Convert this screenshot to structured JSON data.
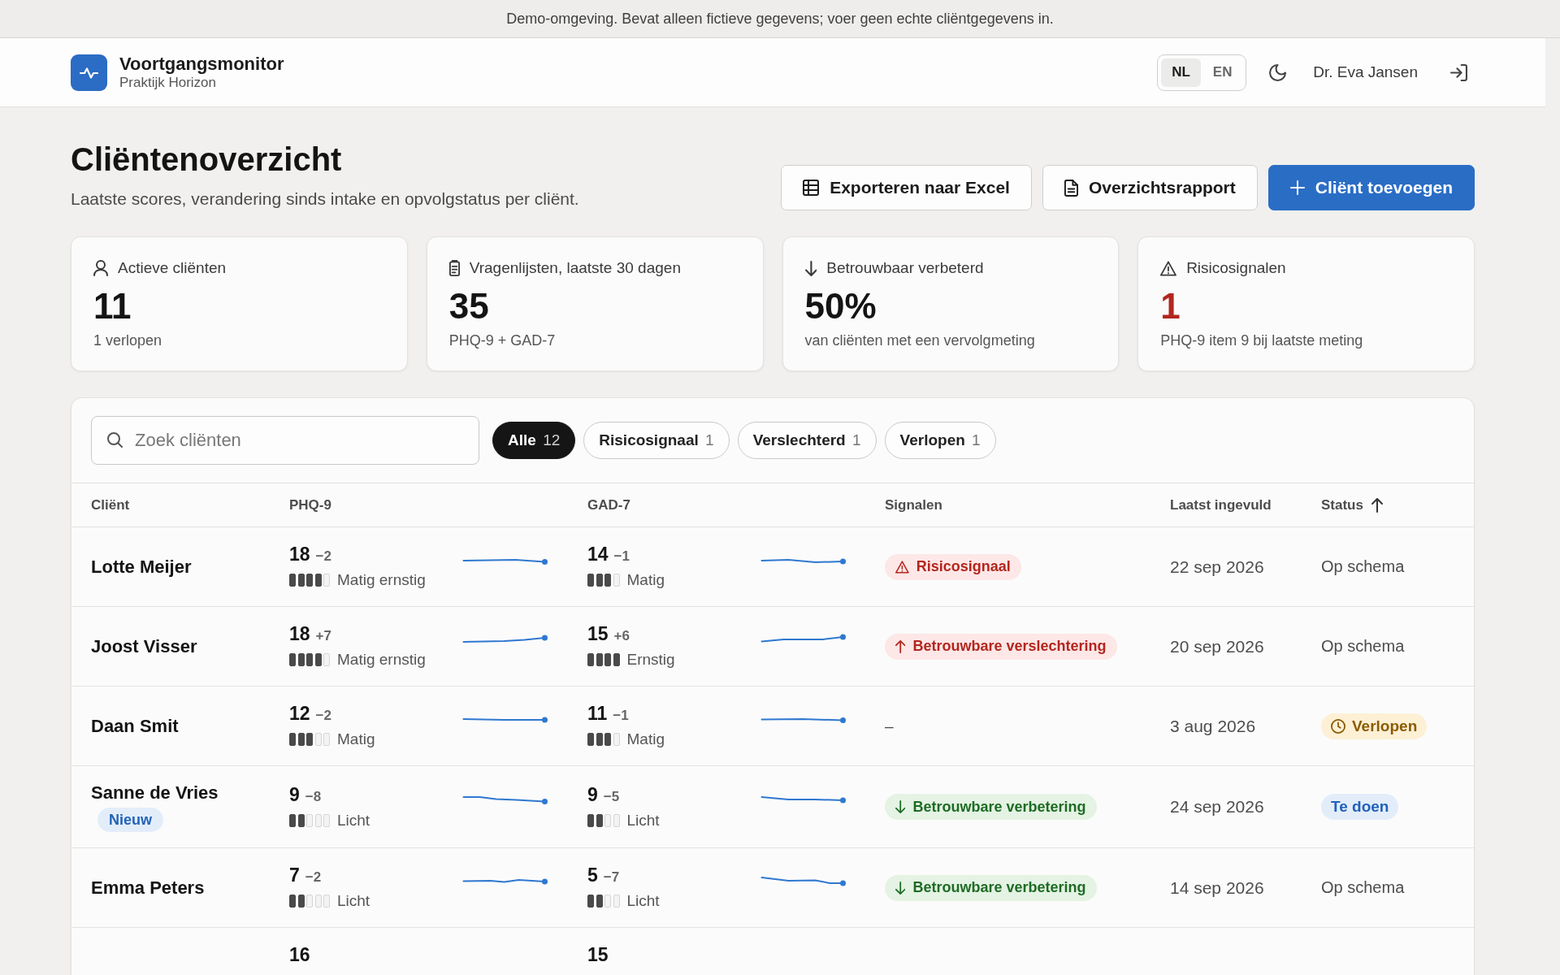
{
  "demo_banner": {
    "text": "Demo-omgeving. Bevat alleen fictieve gegevens; voer geen echte cliëntgegevens in."
  },
  "app_header": {
    "title": "Voortgangsmonitor",
    "subtitle": "Praktijk Horizon",
    "languages": [
      {
        "label": "NL",
        "selected": true
      },
      {
        "label": "EN",
        "selected": false
      }
    ],
    "user": "Dr. Eva Jansen"
  },
  "page": {
    "title": "Cliëntenoverzicht",
    "subtitle": "Laatste scores, verandering sinds intake en opvolgstatus per cliënt.",
    "actions": [
      {
        "label": "Exporteren naar Excel",
        "kind": "secondary"
      },
      {
        "label": "Overzichtsrapport",
        "kind": "secondary"
      },
      {
        "label": "Cliënt toevoegen",
        "kind": "primary"
      }
    ]
  },
  "stats": [
    {
      "label": "Actieve cliënten",
      "value": "11",
      "note": "1 verlopen",
      "alert": false
    },
    {
      "label": "Vragenlijsten, laatste 30 dagen",
      "value": "35",
      "note": "PHQ-9 + GAD-7",
      "alert": false
    },
    {
      "label": "Betrouwbaar verbeterd",
      "value": "50%",
      "note": "van cliënten met een vervolgmeting",
      "alert": false
    },
    {
      "label": "Risicosignalen",
      "value": "1",
      "note": "PHQ-9 item 9 bij laatste meting",
      "alert": true
    }
  ],
  "client_table": {
    "search": {
      "placeholder": "Zoek cliënten"
    },
    "filters": [
      {
        "label": "Alle",
        "count": "12",
        "selected": true
      },
      {
        "label": "Risicosignaal",
        "count": "1",
        "selected": false
      },
      {
        "label": "Verslechterd",
        "count": "1",
        "selected": false
      },
      {
        "label": "Verlopen",
        "count": "1",
        "selected": false
      }
    ],
    "columns": [
      {
        "label": "Cliënt",
        "sorted": false
      },
      {
        "label": "PHQ-9",
        "sorted": false
      },
      {
        "label": "GAD-7",
        "sorted": false
      },
      {
        "label": "Signalen",
        "sorted": false
      },
      {
        "label": "Laatst ingevuld",
        "sorted": false
      },
      {
        "label": "Status",
        "sorted": true
      }
    ],
    "rows": [
      {
        "name": "Lotte Meijer",
        "phq9": {
          "score": "18",
          "change": "−2",
          "level": 0.8,
          "severity": "Matig ernstig"
        },
        "gad7": {
          "score": "14",
          "change": "−1",
          "level": 0.75,
          "severity": "Matig"
        },
        "signal": {
          "kind": "risk",
          "label": "Risicosignaal"
        },
        "last_completed": "22 sep 2026",
        "status": {
          "kind": "plain",
          "label": "Op schema"
        }
      },
      {
        "name": "Joost Visser",
        "phq9": {
          "score": "18",
          "change": "+7",
          "level": 0.8,
          "severity": "Matig ernstig"
        },
        "gad7": {
          "score": "15",
          "change": "+6",
          "level": 1,
          "severity": "Ernstig"
        },
        "signal": {
          "kind": "worse",
          "label": "Betrouwbare verslechtering"
        },
        "last_completed": "20 sep 2026",
        "status": {
          "kind": "plain",
          "label": "Op schema"
        }
      },
      {
        "name": "Daan Smit",
        "phq9": {
          "score": "12",
          "change": "−2",
          "level": 0.6,
          "severity": "Matig"
        },
        "gad7": {
          "score": "11",
          "change": "−1",
          "level": 0.75,
          "severity": "Matig"
        },
        "signal": {
          "kind": "none",
          "label": "–"
        },
        "last_completed": "3 aug 2026",
        "status": {
          "kind": "expired",
          "label": "Verlopen"
        }
      },
      {
        "name": "Sanne de Vries",
        "tag": "Nieuw",
        "phq9": {
          "score": "9",
          "change": "−8",
          "level": 0.4,
          "severity": "Licht"
        },
        "gad7": {
          "score": "9",
          "change": "−5",
          "level": 0.5,
          "severity": "Licht"
        },
        "signal": {
          "kind": "better",
          "label": "Betrouwbare verbetering"
        },
        "last_completed": "24 sep 2026",
        "status": {
          "kind": "todo",
          "label": "Te doen"
        }
      },
      {
        "name": "Emma Peters",
        "phq9": {
          "score": "7",
          "change": "−2",
          "level": 0.4,
          "severity": "Licht"
        },
        "gad7": {
          "score": "5",
          "change": "−7",
          "level": 0.5,
          "severity": "Licht"
        },
        "signal": {
          "kind": "better",
          "label": "Betrouwbare verbetering"
        },
        "last_completed": "14 sep 2026",
        "status": {
          "kind": "plain",
          "label": "Op schema"
        }
      },
      {
        "phq9": {
          "score": "16"
        },
        "gad7": {
          "score": "15"
        }
      }
    ]
  }
}
